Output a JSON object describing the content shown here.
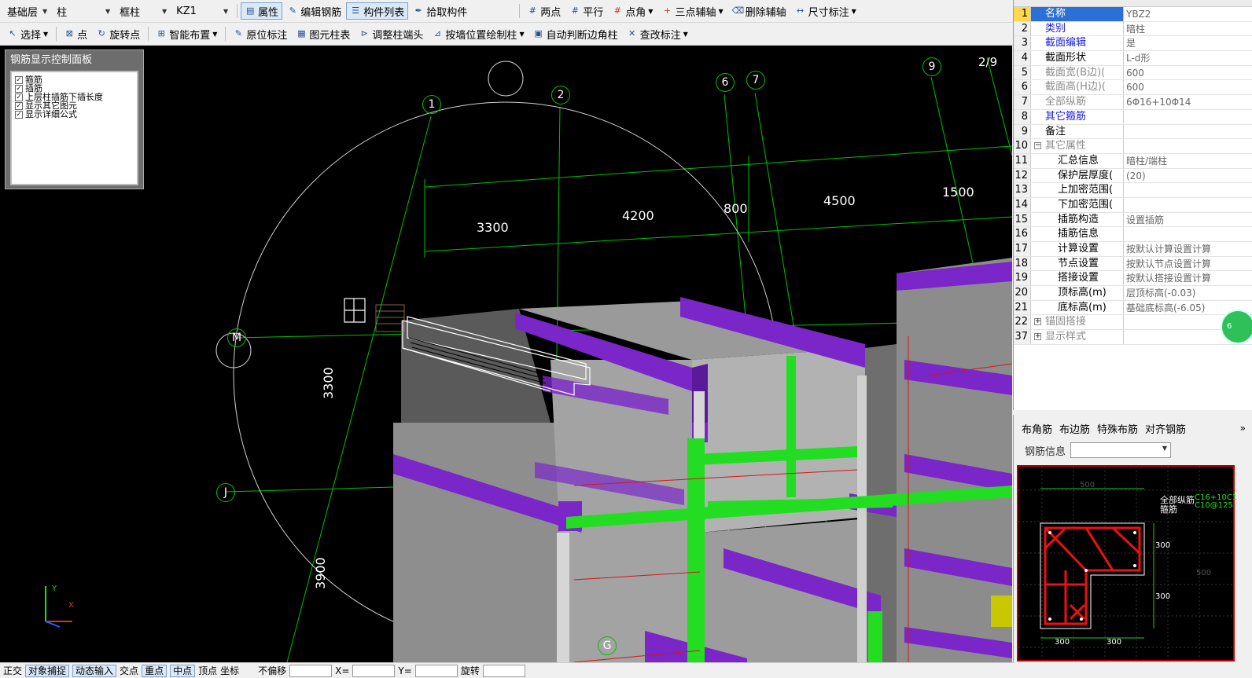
{
  "toolbar1": {
    "combos": [
      {
        "label": "基础层"
      },
      {
        "label": "柱"
      },
      {
        "label": "框柱"
      },
      {
        "label": "KZ1"
      }
    ],
    "buttons": [
      {
        "label": "属性",
        "icon": "properties-icon",
        "active": true
      },
      {
        "label": "编辑钢筋",
        "icon": "edit-rebar-icon",
        "active": false
      },
      {
        "label": "构件列表",
        "icon": "component-list-icon",
        "active": true
      },
      {
        "label": "拾取构件",
        "icon": "pick-component-icon",
        "active": false
      }
    ],
    "axis_tools": [
      {
        "label": "两点",
        "icon": "two-point-axis-icon"
      },
      {
        "label": "平行",
        "icon": "parallel-axis-icon"
      },
      {
        "label": "点角",
        "icon": "point-angle-axis-icon",
        "dropdown": true
      },
      {
        "label": "三点辅轴",
        "icon": "three-point-axis-icon",
        "dropdown": true
      },
      {
        "label": "删除辅轴",
        "icon": "delete-axis-icon"
      },
      {
        "label": "尺寸标注",
        "icon": "dimension-icon",
        "dropdown": true
      }
    ]
  },
  "toolbar2": {
    "buttons": [
      {
        "label": "选择",
        "icon": "select-cursor-icon",
        "dropdown": true
      },
      {
        "label": "点",
        "icon": "point-icon"
      },
      {
        "label": "旋转点",
        "icon": "rotate-point-icon"
      },
      {
        "label": "智能布置",
        "icon": "smart-layout-icon",
        "dropdown": true
      },
      {
        "label": "原位标注",
        "icon": "in-place-annotation-icon"
      },
      {
        "label": "图元柱表",
        "icon": "column-table-icon"
      },
      {
        "label": "调整柱端头",
        "icon": "adjust-column-end-icon"
      },
      {
        "label": "按墙位置绘制柱",
        "icon": "draw-by-wall-icon",
        "dropdown": true
      },
      {
        "label": "自动判断边角柱",
        "icon": "auto-corner-column-icon"
      },
      {
        "label": "查改标注",
        "icon": "check-annotation-icon",
        "dropdown": true
      }
    ]
  },
  "rebar_panel": {
    "title": "钢筋显示控制面板",
    "options": [
      {
        "label": "箍筋",
        "checked": true
      },
      {
        "label": "插筋",
        "checked": true
      },
      {
        "label": "上层柱插筋下插长度",
        "checked": true
      },
      {
        "label": "显示其它图元",
        "checked": true
      },
      {
        "label": "显示详细公式",
        "checked": true
      }
    ]
  },
  "viewport": {
    "axis_labels": [
      "1",
      "2",
      "6",
      "7",
      "9",
      "M",
      "J",
      "G"
    ],
    "page_indicator": "2/9",
    "dimensions": [
      "3300",
      "4200",
      "800",
      "4500",
      "1500",
      "3300",
      "3900"
    ]
  },
  "properties": {
    "rows": [
      {
        "num": "1",
        "name": "名称",
        "value": "YBZ2",
        "style": "sel"
      },
      {
        "num": "2",
        "name": "类别",
        "value": "暗柱",
        "style": "blue"
      },
      {
        "num": "3",
        "name": "截面编辑",
        "value": "是",
        "style": "blue"
      },
      {
        "num": "4",
        "name": "截面形状",
        "value": "L-d形",
        "style": ""
      },
      {
        "num": "5",
        "name": "截面宽(B边)(",
        "value": "600",
        "style": "gray"
      },
      {
        "num": "6",
        "name": "截面高(H边)(",
        "value": "600",
        "style": "gray"
      },
      {
        "num": "7",
        "name": "全部纵筋",
        "value": "6Φ16+10Φ14",
        "style": "gray"
      },
      {
        "num": "8",
        "name": "其它箍筋",
        "value": "",
        "style": "blue"
      },
      {
        "num": "9",
        "name": "备注",
        "value": "",
        "style": ""
      },
      {
        "num": "10",
        "name": "其它属性",
        "value": "",
        "style": "gray",
        "tree": "−"
      },
      {
        "num": "11",
        "name": "汇总信息",
        "value": "暗柱/端柱",
        "style": "child"
      },
      {
        "num": "12",
        "name": "保护层厚度(",
        "value": "(20)",
        "style": "child"
      },
      {
        "num": "13",
        "name": "上加密范围(",
        "value": "",
        "style": "child"
      },
      {
        "num": "14",
        "name": "下加密范围(",
        "value": "",
        "style": "child"
      },
      {
        "num": "15",
        "name": "插筋构造",
        "value": "设置插筋",
        "style": "child"
      },
      {
        "num": "16",
        "name": "插筋信息",
        "value": "",
        "style": "child"
      },
      {
        "num": "17",
        "name": "计算设置",
        "value": "按默认计算设置计算",
        "style": "child"
      },
      {
        "num": "18",
        "name": "节点设置",
        "value": "按默认节点设置计算",
        "style": "child"
      },
      {
        "num": "19",
        "name": "搭接设置",
        "value": "按默认搭接设置计算",
        "style": "child"
      },
      {
        "num": "20",
        "name": "顶标高(m)",
        "value": "层顶标高(-0.03)",
        "style": "child"
      },
      {
        "num": "21",
        "name": "底标高(m)",
        "value": "基础底标高(-6.05)",
        "style": "child"
      },
      {
        "num": "22",
        "name": "锚固搭接",
        "value": "",
        "style": "gray",
        "tree": "+"
      },
      {
        "num": "37",
        "name": "显示样式",
        "value": "",
        "style": "gray",
        "tree": "+"
      }
    ]
  },
  "rebar_tabs": [
    "布角筋",
    "布边筋",
    "特殊布筋",
    "对齐钢筋"
  ],
  "rebar_info_label": "钢筋信息",
  "section_preview": {
    "top_dim": "500",
    "right_dim": "500",
    "dims": [
      "300",
      "300",
      "300",
      "300"
    ],
    "labels": [
      "全部纵筋",
      "箍筋"
    ],
    "rebar_text": [
      "C16+10C1",
      "C10@125"
    ]
  },
  "statusbar": {
    "items": [
      "正交",
      "对象捕捉",
      "动态输入",
      "交点",
      "重点",
      "中点",
      "顶点",
      "坐标",
      "不偏移",
      "X=",
      "Y=",
      "旋转"
    ]
  },
  "green_badge": "6",
  "colors": {
    "grid": "#00c000",
    "beam_purple": "#7a26c9",
    "column_gray": "#b8b8b8",
    "rebar_green": "#22dd22",
    "selection_blue": "#2b6fd9"
  }
}
